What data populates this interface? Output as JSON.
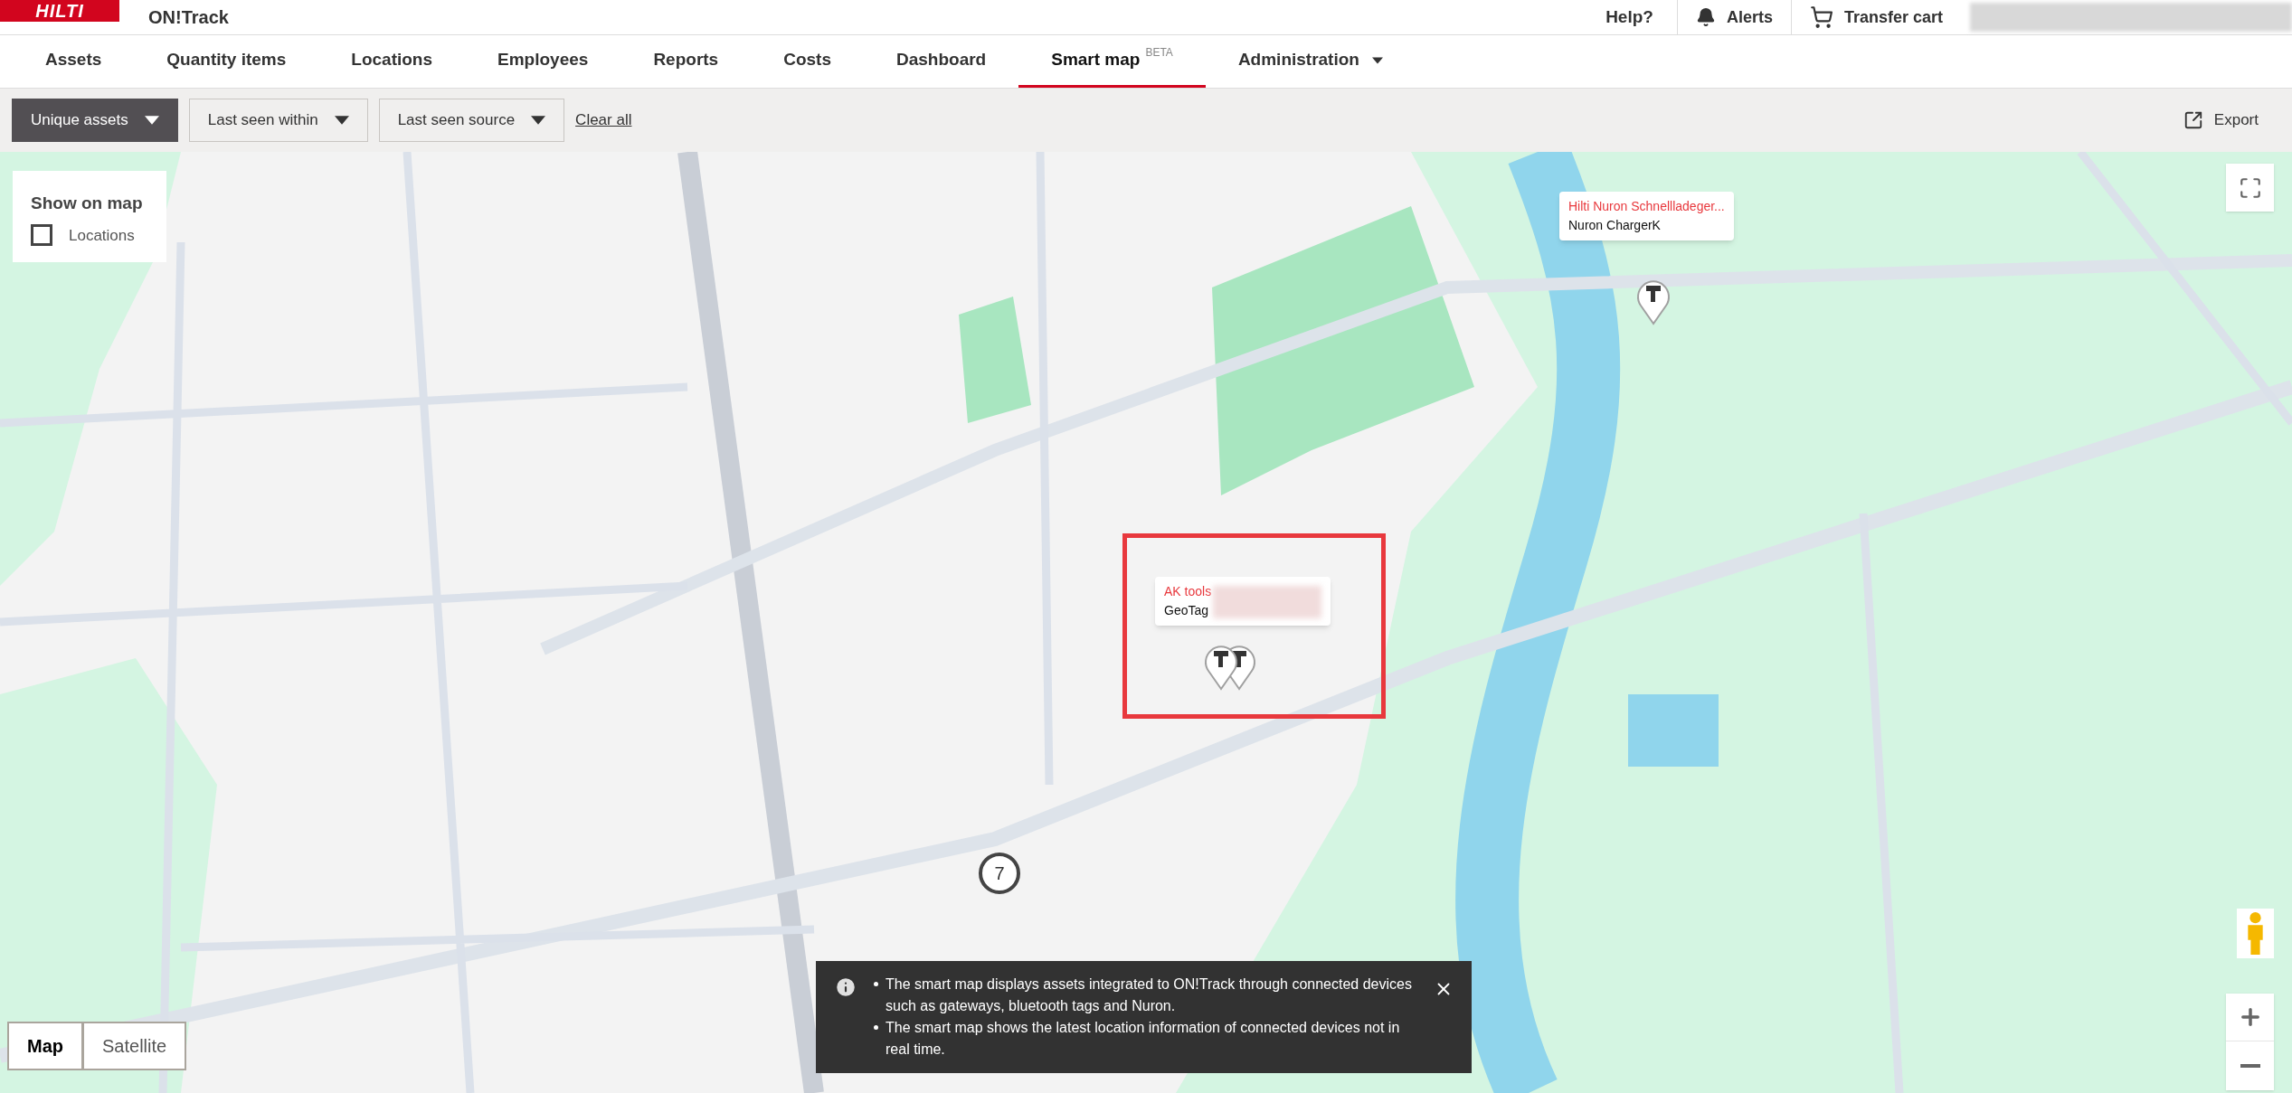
{
  "header": {
    "logo": "HILTI",
    "app_name": "ON!Track",
    "help": "Help?",
    "alerts": "Alerts",
    "transfer_cart": "Transfer cart"
  },
  "nav_tabs": [
    {
      "label": "Assets",
      "dropdown": false,
      "selected": false
    },
    {
      "label": "Quantity items",
      "dropdown": false,
      "selected": false
    },
    {
      "label": "Locations",
      "dropdown": false,
      "selected": false
    },
    {
      "label": "Employees",
      "dropdown": false,
      "selected": false
    },
    {
      "label": "Reports",
      "dropdown": false,
      "selected": false
    },
    {
      "label": "Costs",
      "dropdown": false,
      "selected": false
    },
    {
      "label": "Dashboard",
      "dropdown": false,
      "selected": false
    },
    {
      "label": "Smart map",
      "badge": "BETA",
      "dropdown": false,
      "selected": true
    },
    {
      "label": "Administration",
      "dropdown": true,
      "selected": false
    }
  ],
  "toolbar": {
    "filters": [
      {
        "label": "Unique assets",
        "selected": true
      },
      {
        "label": "Last seen within",
        "selected": false
      },
      {
        "label": "Last seen source",
        "selected": false
      }
    ],
    "clear_all": "Clear all",
    "export": "Export"
  },
  "map": {
    "show_on_map": {
      "title": "Show on map",
      "options": [
        {
          "label": "Locations",
          "checked": false
        }
      ]
    },
    "popups": [
      {
        "title": "Hilti Nuron Schnellladeger...",
        "subtitle": "Nuron ChargerK"
      },
      {
        "title": "AK tools",
        "subtitle": "GeoTag"
      }
    ],
    "cluster": "7",
    "map_types": [
      {
        "label": "Map",
        "selected": true
      },
      {
        "label": "Satellite",
        "selected": false
      }
    ],
    "notice": {
      "items": [
        "The smart map displays assets integrated to ON!Track through connected devices such as gateways, bluetooth tags and Nuron.",
        "The smart map shows the latest location information of connected devices not in real time."
      ]
    }
  }
}
